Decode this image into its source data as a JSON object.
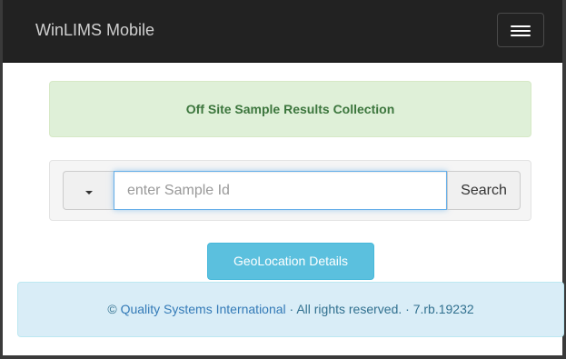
{
  "navbar": {
    "brand": "WinLIMS Mobile",
    "menu_icon": "hamburger-icon"
  },
  "alert": {
    "text": "Off Site Sample Results Collection"
  },
  "search": {
    "placeholder": "enter Sample Id",
    "value": "",
    "dropdown_icon": "caret-down-icon",
    "button_label": "Search"
  },
  "geolocation": {
    "button_label": "GeoLocation Details"
  },
  "footer": {
    "copyright_symbol": "©",
    "company_link": "Quality Systems International",
    "rights": " · All rights reserved. · 7.rb.19232"
  },
  "colors": {
    "navbar_bg": "#222222",
    "alert_bg": "#dff0d8",
    "alert_text": "#3c763d",
    "info_bg": "#d9edf7",
    "info_button": "#5bc0de",
    "link": "#337ab7"
  }
}
